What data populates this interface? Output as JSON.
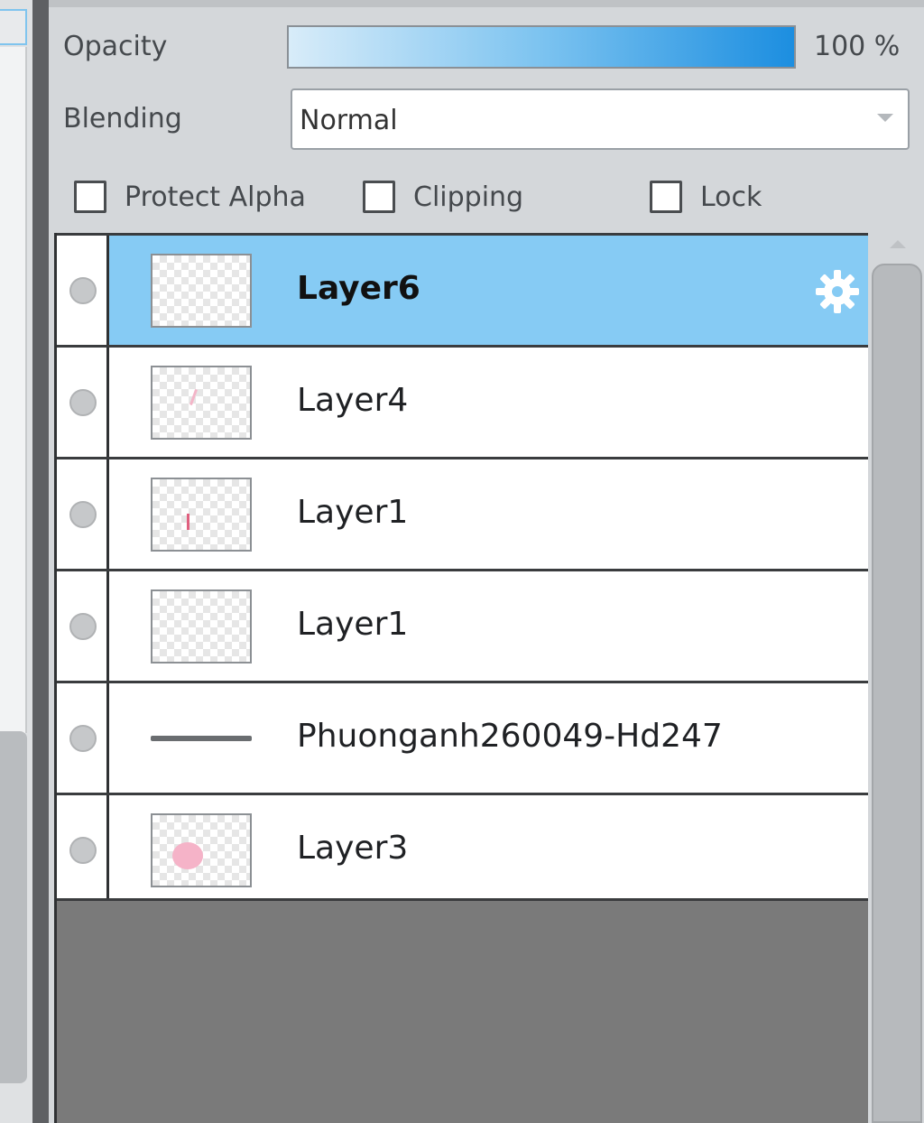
{
  "properties": {
    "opacity_label": "Opacity",
    "opacity_value": "100 %",
    "opacity_level": 1.0,
    "blending_label": "Blending",
    "blending_value": "Normal"
  },
  "options": {
    "protect_alpha": {
      "label": "Protect Alpha",
      "checked": false
    },
    "clipping": {
      "label": "Clipping",
      "checked": false
    },
    "lock": {
      "label": "Lock",
      "checked": false
    }
  },
  "layers": [
    {
      "name": "Layer6",
      "selected": true,
      "thumbnail": "empty"
    },
    {
      "name": "Layer4",
      "selected": false,
      "thumbnail": "faint-mark"
    },
    {
      "name": "Layer1",
      "selected": false,
      "thumbnail": "red-mark"
    },
    {
      "name": "Layer1",
      "selected": false,
      "thumbnail": "empty"
    },
    {
      "name": "Phuonganh260049-Hd247",
      "selected": false,
      "thumbnail": "line"
    },
    {
      "name": "Layer3",
      "selected": false,
      "thumbnail": "pink-blob"
    }
  ],
  "icons": {
    "settings": "gear-icon",
    "dropdown": "chevron-down-icon",
    "visibility": "visibility-dot-icon"
  },
  "colors": {
    "selected_row": "#86cbf4",
    "opacity_bar_start": "#d8ecf9",
    "opacity_bar_end": "#1c8ee0",
    "empty_area": "#7a7a7a"
  }
}
